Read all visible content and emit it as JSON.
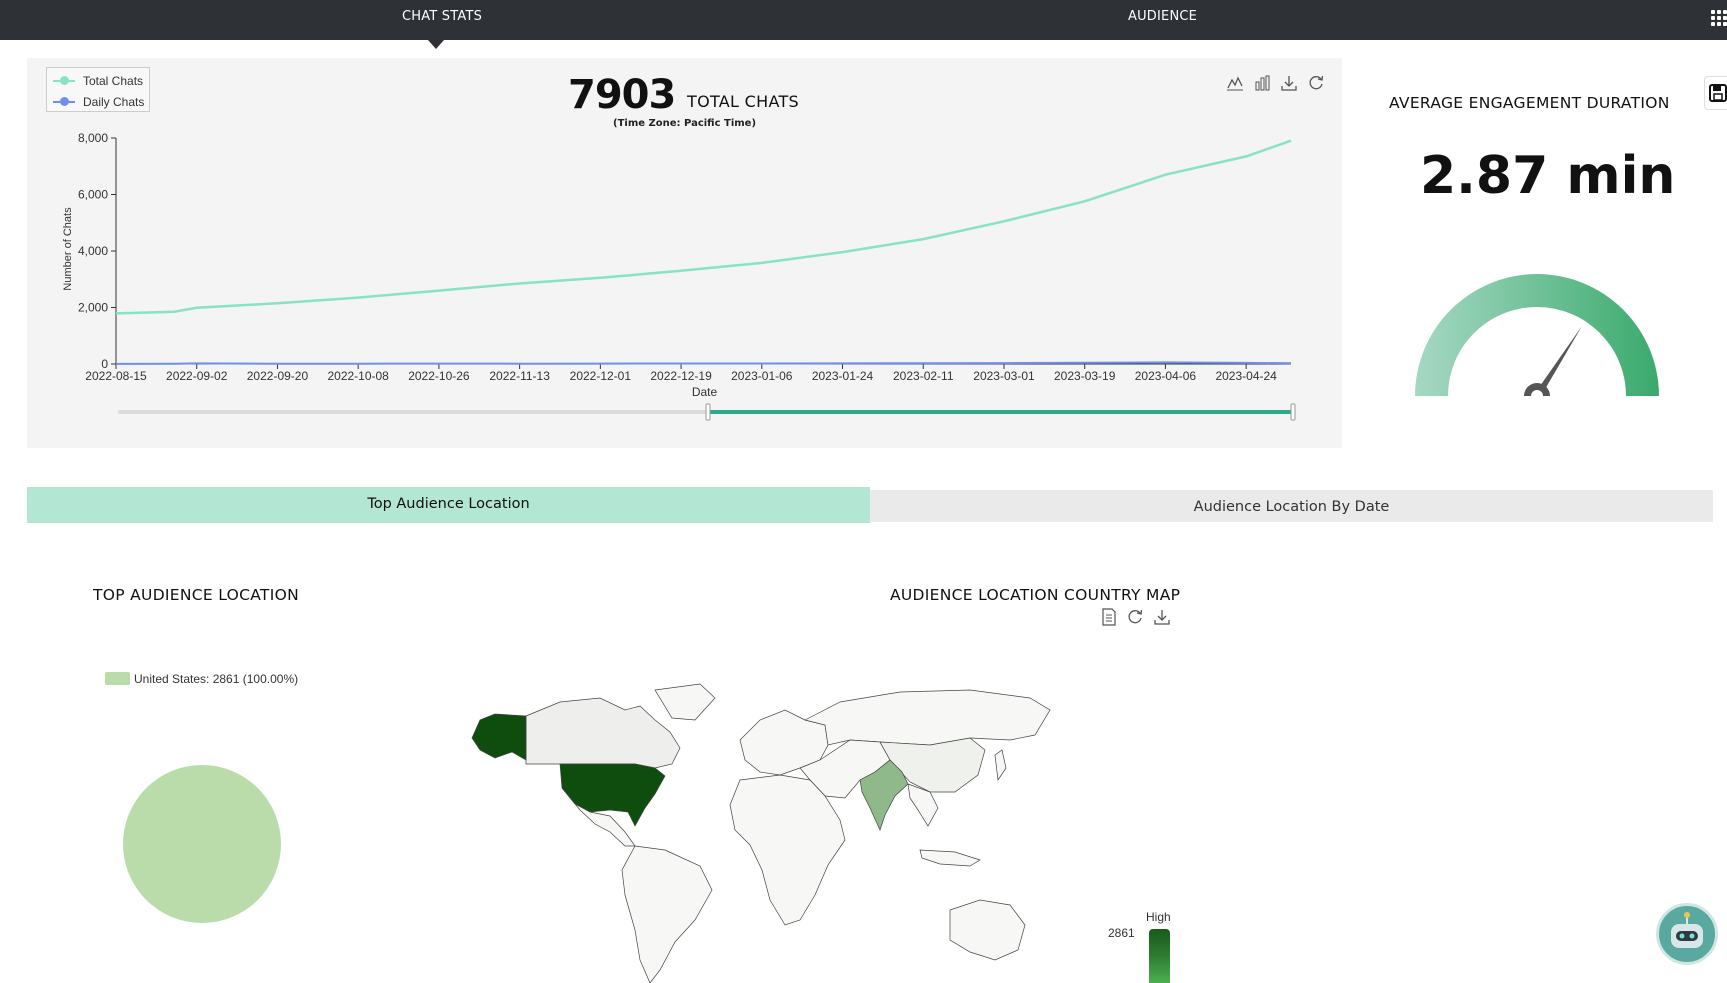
{
  "nav": {
    "tabs": [
      {
        "label": "CHAT STATS",
        "active": true
      },
      {
        "label": "AUDIENCE",
        "active": false
      }
    ]
  },
  "chat_stats": {
    "total_value": "7903",
    "total_label": "TOTAL CHATS",
    "timezone": "(Time Zone: Pacific Time)",
    "legend": [
      {
        "name": "Total Chats",
        "color": "#86e3c3"
      },
      {
        "name": "Daily Chats",
        "color": "#6f8fef"
      }
    ],
    "toolbar_icons": [
      "line-chart-icon",
      "bar-chart-icon",
      "download-icon",
      "refresh-icon"
    ]
  },
  "chart_data": {
    "type": "line",
    "xlabel": "Date",
    "ylabel": "Number of Chats",
    "ylim": [
      0,
      8000
    ],
    "yticks": [
      "0",
      "2,000",
      "4,000",
      "6,000",
      "8,000"
    ],
    "xticks": [
      "2022-08-15",
      "2022-09-02",
      "2022-09-20",
      "2022-10-08",
      "2022-10-26",
      "2022-11-13",
      "2022-12-01",
      "2022-12-19",
      "2023-01-06",
      "2023-01-24",
      "2023-02-11",
      "2023-03-01",
      "2023-03-19",
      "2023-04-06",
      "2023-04-24"
    ],
    "x": [
      "2022-08-15",
      "2022-08-28",
      "2022-09-02",
      "2022-09-20",
      "2022-10-08",
      "2022-10-26",
      "2022-11-13",
      "2022-12-01",
      "2022-12-19",
      "2023-01-06",
      "2023-01-24",
      "2023-02-11",
      "2023-03-01",
      "2023-03-19",
      "2023-04-06",
      "2023-04-24",
      "2023-05-04"
    ],
    "series": [
      {
        "name": "Total Chats",
        "values": [
          1790,
          1850,
          1990,
          2150,
          2350,
          2600,
          2850,
          3050,
          3300,
          3580,
          3960,
          4420,
          5050,
          5760,
          6700,
          7350,
          7903
        ]
      },
      {
        "name": "Daily Chats",
        "values": [
          5,
          8,
          20,
          10,
          12,
          15,
          12,
          14,
          16,
          18,
          22,
          28,
          32,
          45,
          55,
          40,
          30
        ]
      }
    ],
    "grid": false,
    "legend_position": "top-left"
  },
  "engagement": {
    "title": "AVERAGE ENGAGEMENT DURATION",
    "value": "2.87 min"
  },
  "subtabs": [
    {
      "label": "Top Audience Location",
      "active": true
    },
    {
      "label": "Audience Location By Date",
      "active": false
    }
  ],
  "top_location": {
    "title": "TOP AUDIENCE LOCATION",
    "legend": "United States: 2861 (100.00%)",
    "color": "#b9dcaa"
  },
  "country_map": {
    "title": "AUDIENCE LOCATION COUNTRY MAP",
    "scale_high_label": "High",
    "scale_value": "2861"
  }
}
